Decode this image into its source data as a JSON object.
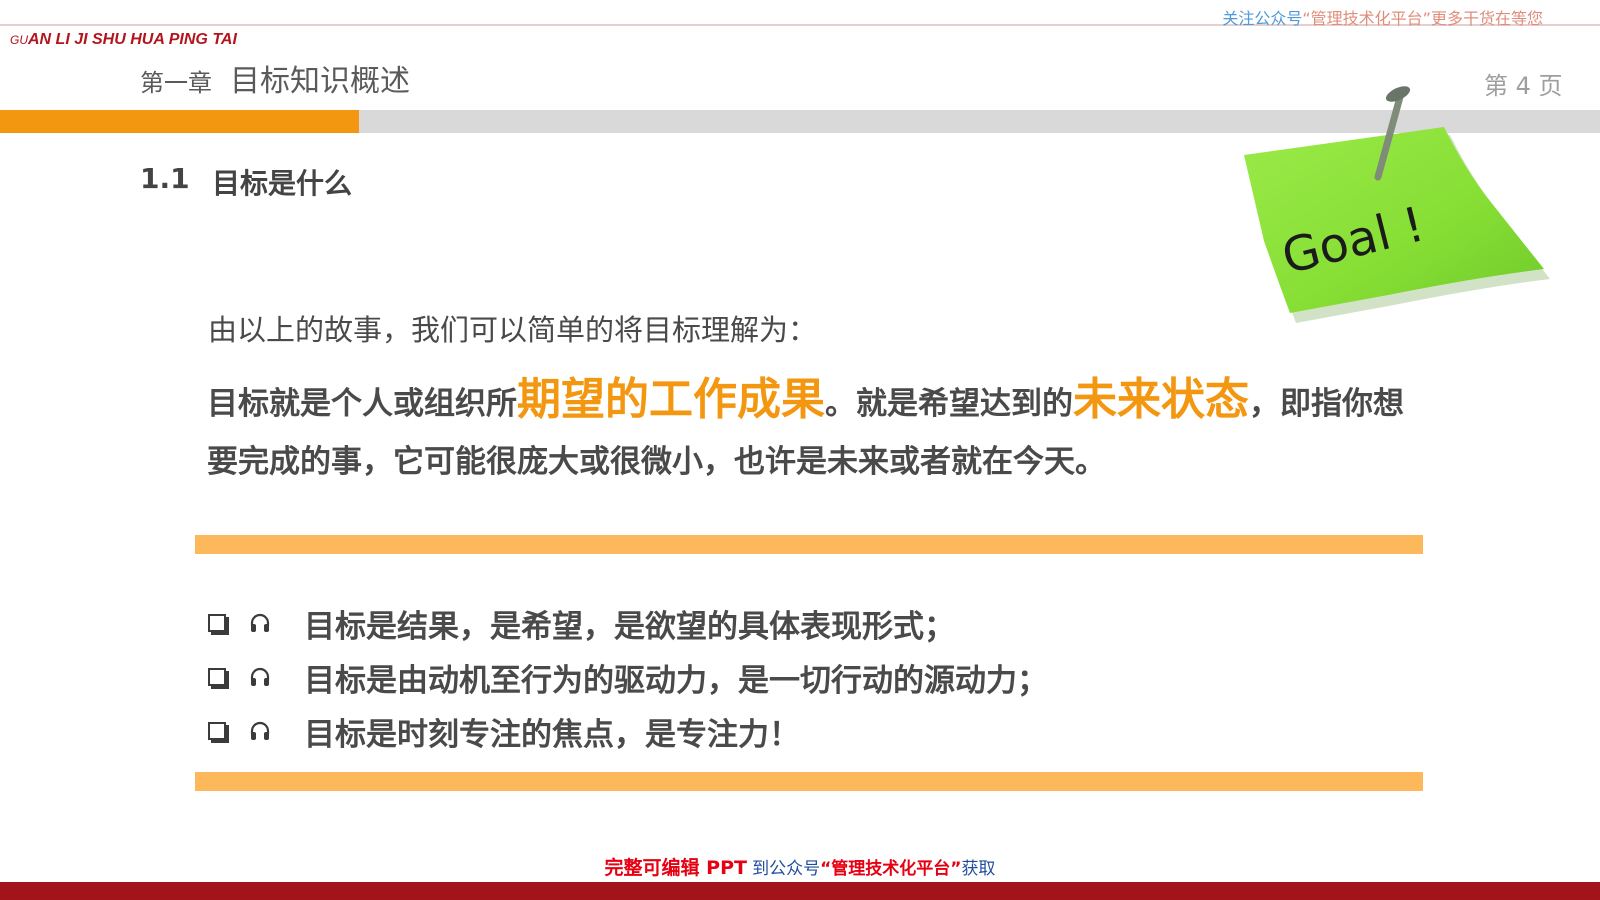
{
  "header": {
    "promo_part1": "关注公众号",
    "promo_part2": "“管理技术化平台”",
    "promo_part3": "更多干货在等您",
    "brand_prefix": "GU",
    "brand_rest": "AN LI JI SHU HUA PING TAI",
    "chapter_label": "第一章",
    "chapter_title": "目标知识概述",
    "page_number": "第 4 页"
  },
  "section": {
    "number": "1.1",
    "title": "目标是什么"
  },
  "content": {
    "intro": "由以上的故事，我们可以简单的将目标理解为：",
    "definition_part1": "目标就是个人或组织所",
    "definition_highlight1": "期望的工作成果",
    "definition_part2": "。就是希望达到的",
    "definition_highlight2": "未来状态",
    "definition_part3": "，即指你想要完成的事，它可能很庞大或很微小，也许是未来或者就在今天。",
    "bullets": [
      "目标是结果，是希望，是欲望的具体表现形式；",
      "目标是由动机至行为的驱动力，是一切行动的源动力；",
      "目标是时刻专注的焦点，是专注力！"
    ]
  },
  "note_image": {
    "text": "Goal !"
  },
  "footer": {
    "cta_part1": "完整可编辑 PPT",
    "cta_part2": "到公众号",
    "cta_part3": "“管理技术化平台”",
    "cta_part4": "获取"
  },
  "colors": {
    "accent_orange": "#f39711",
    "band_orange": "#fdb85c",
    "brand_red": "#b3151c",
    "footer_red": "#a3141a",
    "note_green": "#8ee23a"
  }
}
